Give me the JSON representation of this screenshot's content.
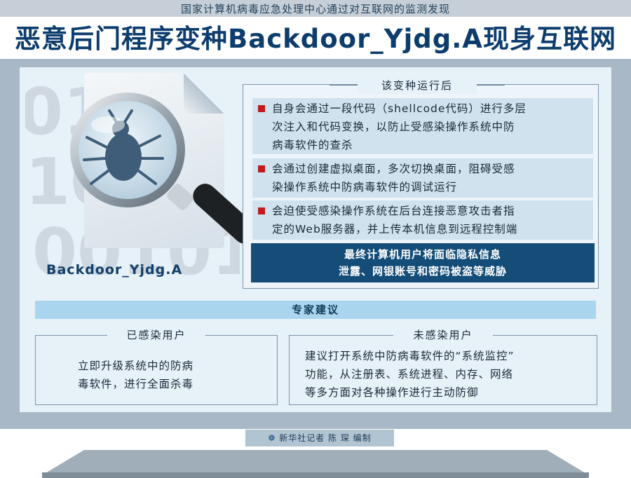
{
  "header": {
    "kicker": "国家计算机病毒应急处理中心通过对互联网的监测发现",
    "title": "恶意后门程序变种Backdoor_Yjdg.A现身互联网"
  },
  "illustration": {
    "label": "Backdoor_Yjdg.A",
    "icon": "magnifier-bug-icon"
  },
  "after_run": {
    "title": "该变种运行后",
    "items": [
      {
        "line1": "自身会通过一段代码（shellcode代码）进行多层",
        "line2": "次注入和代码变换，以防止受感染操作系统中防",
        "line3": "病毒软件的查杀"
      },
      {
        "line1": "会通过创建虚拟桌面，多次切换桌面，阻碍受感",
        "line2": "染操作系统中防病毒软件的调试运行"
      },
      {
        "line1": "会迫使受感染操作系统在后台连接恶意攻击者指",
        "line2": "定的Web服务器，并上传本机信息到远程控制端"
      }
    ],
    "warning_line1": "最终计算机用户将面临隐私信息",
    "warning_line2": "泄露、网银账号和密码被盗等威胁"
  },
  "advice": {
    "title": "专家建议",
    "infected": {
      "title": "已感染用户",
      "line1": "立即升级系统中的防病",
      "line2": "毒软件，进行全面杀毒"
    },
    "uninfected": {
      "title": "未感染用户",
      "line1": "建议打开系统中防病毒软件的“系统监控”",
      "line2": "功能，从注册表、系统进程、内存、网络",
      "line3": "等多方面对各种操作进行主动防御"
    }
  },
  "credit": "新华社记者 陈 琛 编制",
  "colors": {
    "title": "#0d3d6d",
    "bullet_marker": "#c31b1b",
    "warning_bg": "#134d78",
    "expert_bar": "#a9d6ee",
    "monitor_frame": "#a9b8c6"
  }
}
